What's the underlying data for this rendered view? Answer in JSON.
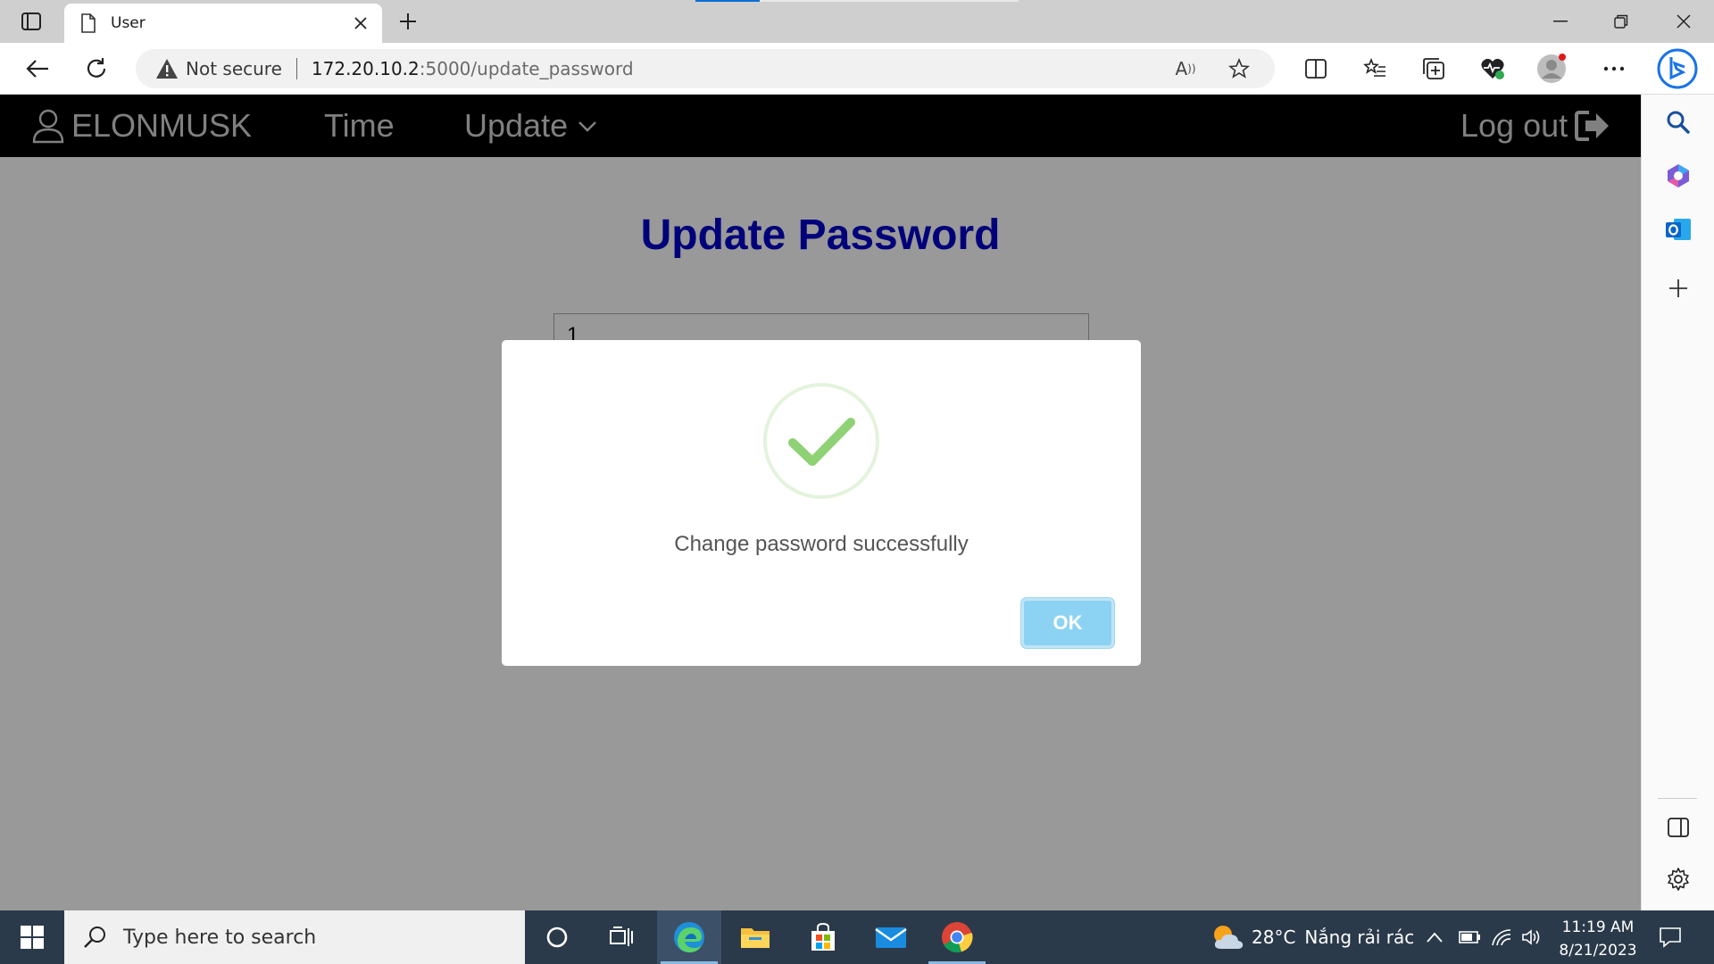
{
  "browser": {
    "tab": {
      "title": "User"
    },
    "address": {
      "security_label": "Not secure",
      "url_host": "172.20.10.2",
      "url_path": ":5000/update_password"
    }
  },
  "app_nav": {
    "user_label": "ELONMUSK",
    "time_label": "Time",
    "update_label": "Update",
    "logout_label": "Log out"
  },
  "page": {
    "title": "Update Password",
    "password_value": "1"
  },
  "dialog": {
    "message": "Change password successfully",
    "ok_label": "OK",
    "icon": "success-check-icon",
    "check_color": "#8fd175"
  },
  "taskbar": {
    "search_placeholder": "Type here to search",
    "weather_temp": "28°C",
    "weather_text": "Nắng rải rác",
    "time": "11:19 AM",
    "date": "8/21/2023"
  },
  "colors": {
    "nav_bg": "#000000",
    "title": "#0000cc",
    "ok_button": "#8cd3f3"
  }
}
